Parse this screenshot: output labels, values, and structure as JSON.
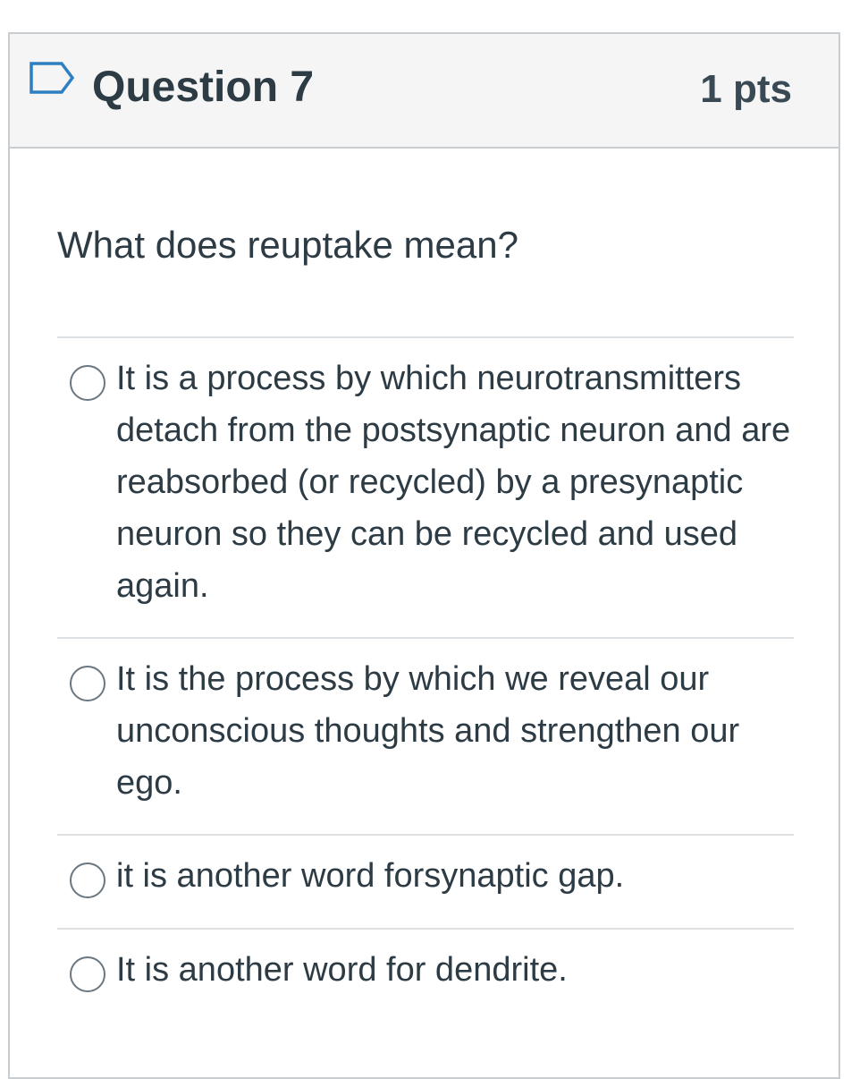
{
  "question": {
    "title": "Question 7",
    "points": "1 pts",
    "flag_icon": "flag-outline-icon",
    "text": "What does reuptake mean?"
  },
  "answers": [
    {
      "label": "It is a process by which neurotransmitters detach from the postsynaptic neuron and are reabsorbed (or recycled) by a presynaptic neuron so they can be recycled and used again.",
      "selected": false
    },
    {
      "label": "It is the process by which we reveal our unconscious thoughts and strengthen our ego.",
      "selected": false
    },
    {
      "label": "it is another word forsynaptic gap.",
      "selected": false
    },
    {
      "label": "It is another word for dendrite.",
      "selected": false
    }
  ],
  "colors": {
    "header_bg": "#f5f5f5",
    "border": "#c7cdd1",
    "divider": "#dde1e4",
    "text": "#2d3b45",
    "flag": "#2d7fc1"
  }
}
